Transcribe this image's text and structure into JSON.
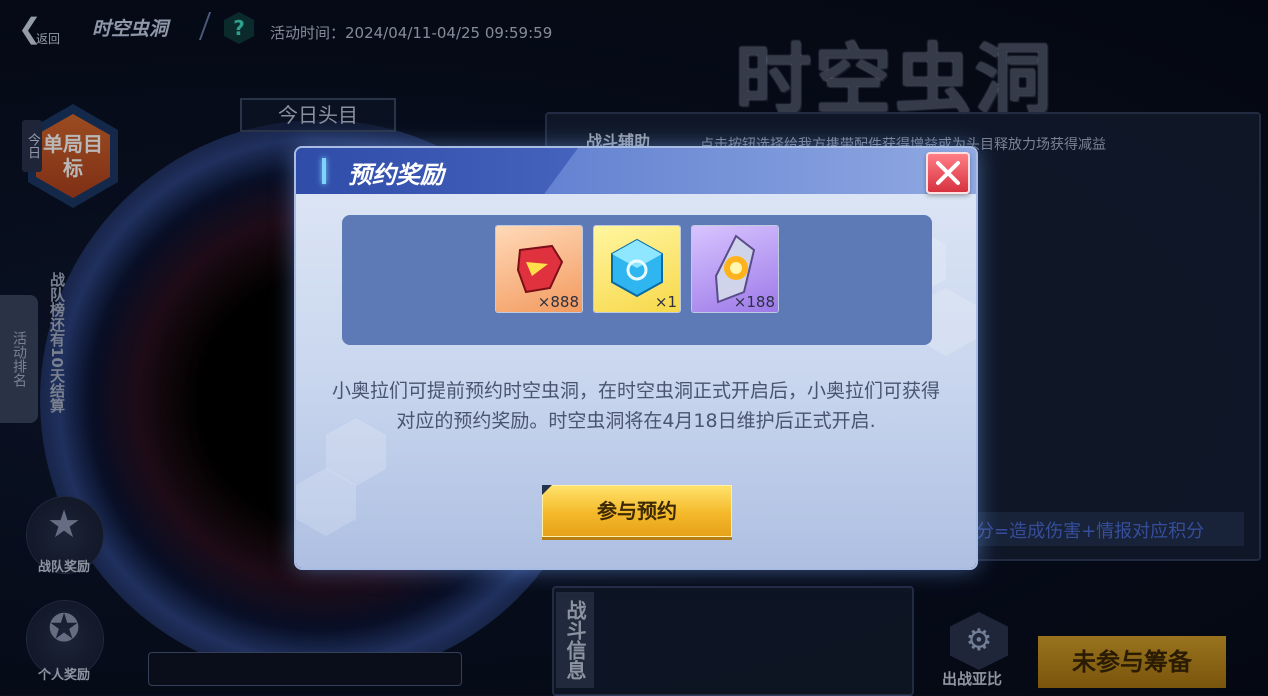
{
  "header": {
    "back_label": "返回",
    "title": "时空虫洞",
    "help_icon": "?",
    "activity_time": "活动时间：2024/04/11-04/25 09:59:59"
  },
  "background": {
    "big_title": "时空虫洞",
    "today_head": "今日头目",
    "today_tab": "今日",
    "single_goal": "单局目标",
    "activity_rank_tab": "活动排名",
    "team_countdown": "战队榜还有10天结算",
    "team_reward": "战队奖励",
    "personal_reward": "个人奖励",
    "battle_assist": "战斗辅助",
    "battle_assist_tip": "点击按钮选择给我方携带配件获得增益或为头目释放力场获得减益",
    "score_formula": "分=造成伤害+情报对应积分",
    "battle_info": "战斗信息",
    "ally_label": "出战亚比",
    "not_joined": "未参与筹备"
  },
  "modal": {
    "title": "预约奖励",
    "rewards": [
      {
        "name": "red-crystal",
        "qty": "×888"
      },
      {
        "name": "blue-cube",
        "qty": "×1"
      },
      {
        "name": "gold-crystal",
        "qty": "×188"
      }
    ],
    "description": "小奥拉们可提前预约时空虫洞，在时空虫洞正式开启后，小奥拉们可获得对应的预约奖励。时空虫洞将在4月18日维护后正式开启.",
    "join_button": "参与预约"
  },
  "colors": {
    "accent_gold": "#f4b92a",
    "close_red": "#d6323f",
    "modal_header_blue": "#2f4da8"
  }
}
